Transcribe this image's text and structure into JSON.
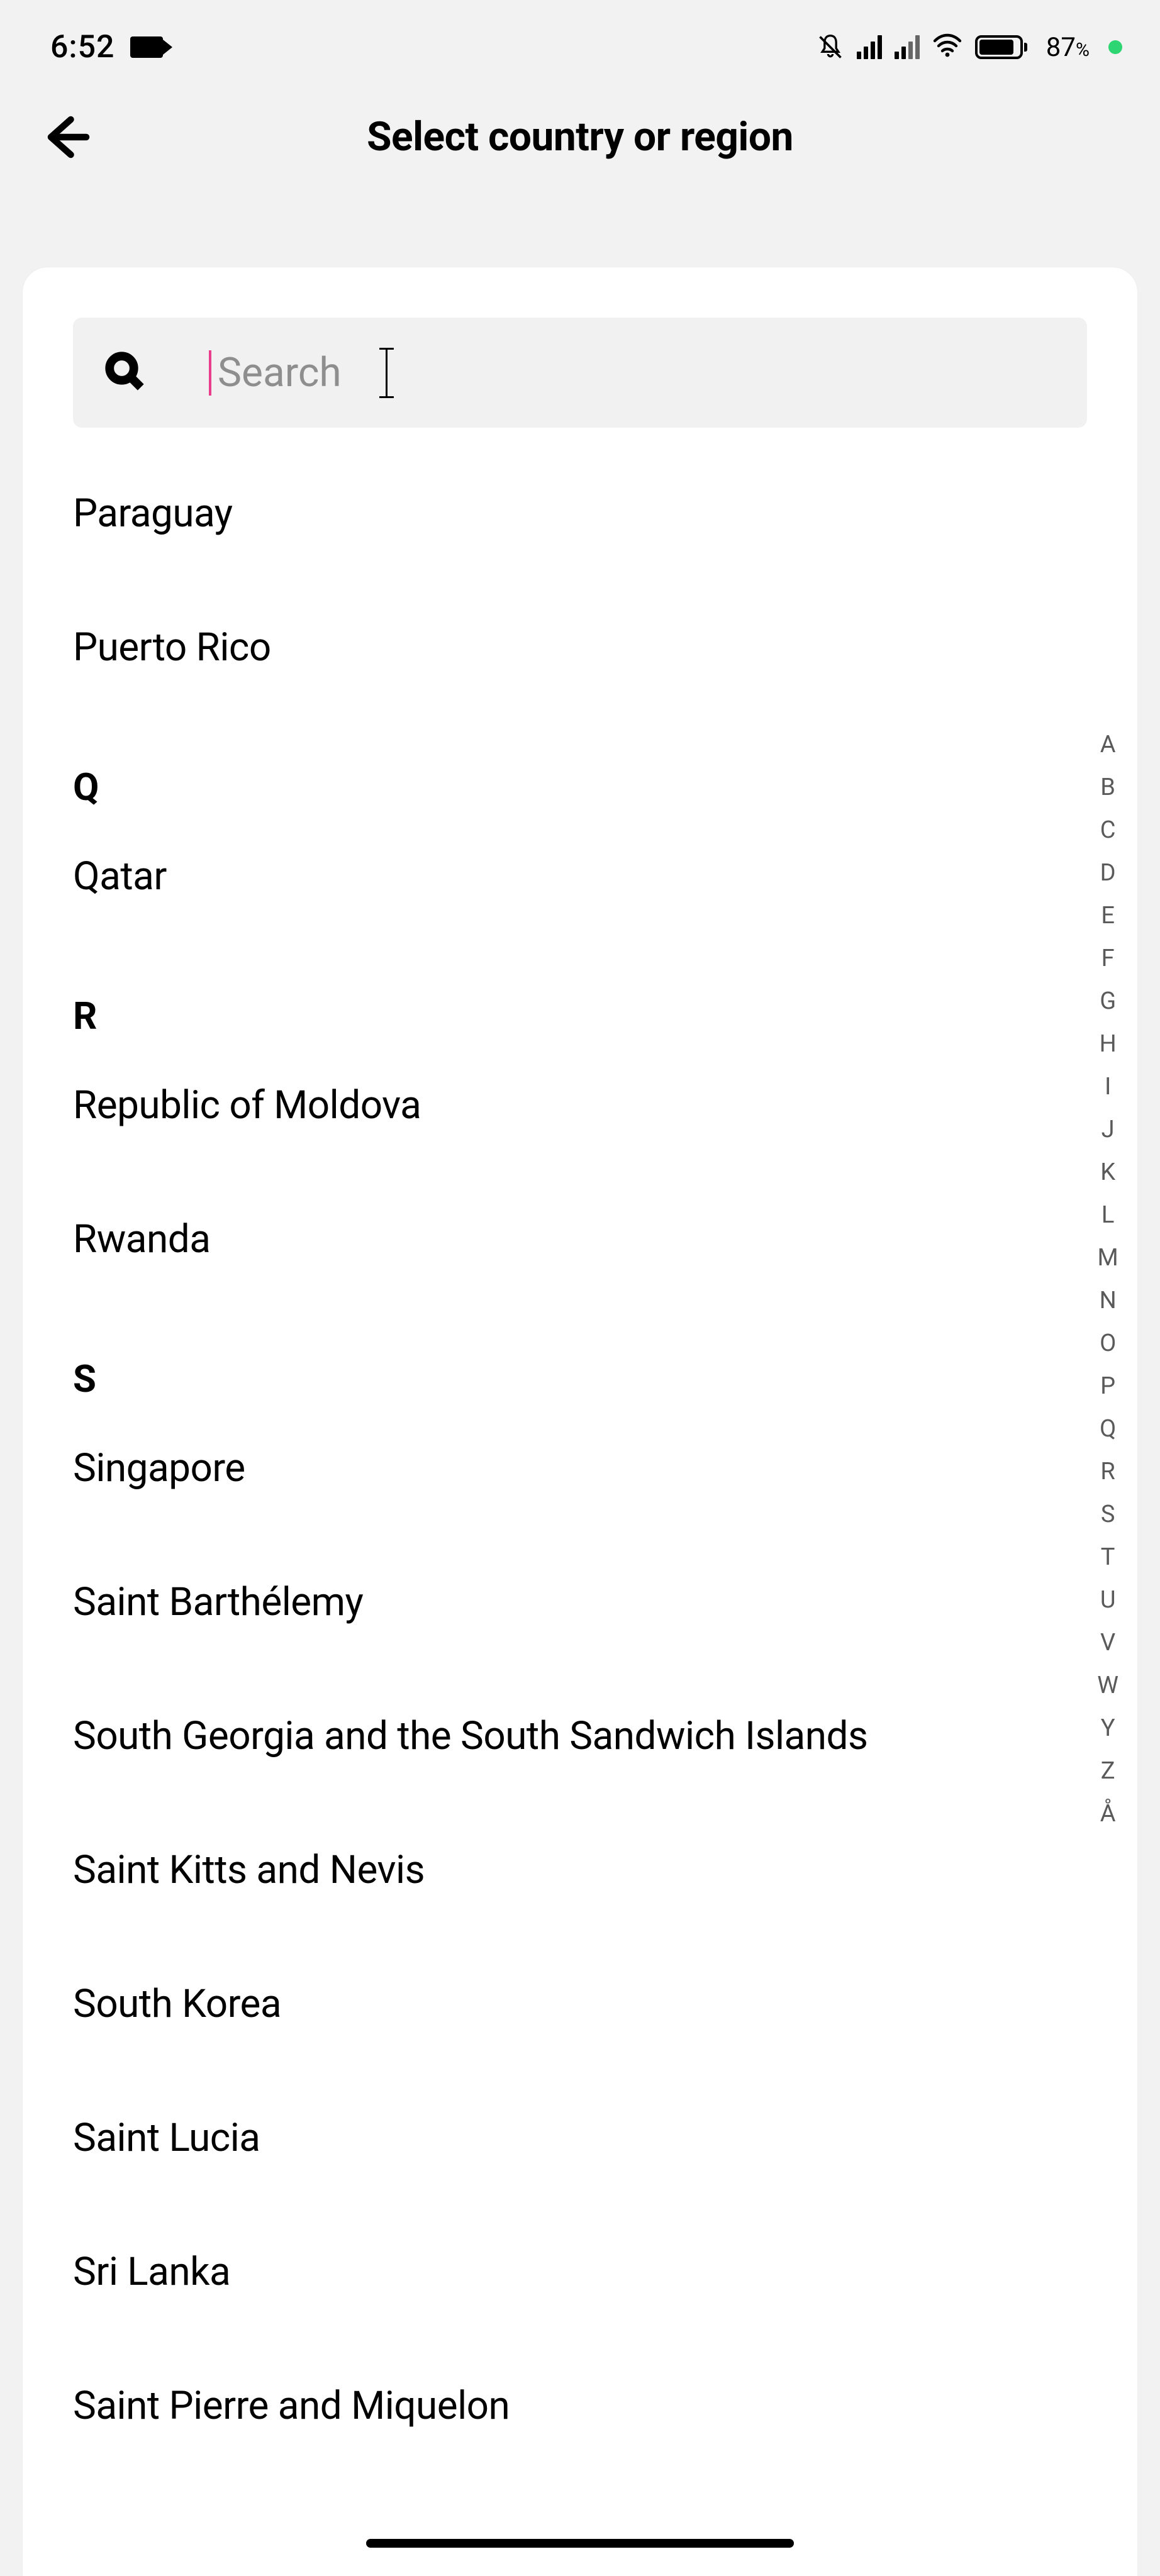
{
  "status": {
    "time": "6:52",
    "battery_pct": "87",
    "battery_unit": "%"
  },
  "header": {
    "title": "Select country or region"
  },
  "search": {
    "placeholder": "Search"
  },
  "sections": [
    {
      "letter": null,
      "items": [
        "Paraguay",
        "Puerto Rico"
      ]
    },
    {
      "letter": "Q",
      "items": [
        "Qatar"
      ]
    },
    {
      "letter": "R",
      "items": [
        "Republic of Moldova",
        "Rwanda"
      ]
    },
    {
      "letter": "S",
      "items": [
        "Singapore",
        "Saint Barthélemy",
        "South Georgia and the South Sandwich Islands",
        "Saint Kitts and Nevis",
        "South Korea",
        "Saint Lucia",
        "Sri Lanka",
        "Saint Pierre and Miquelon"
      ]
    }
  ],
  "alpha_index": [
    "A",
    "B",
    "C",
    "D",
    "E",
    "F",
    "G",
    "H",
    "I",
    "J",
    "K",
    "L",
    "M",
    "N",
    "O",
    "P",
    "Q",
    "R",
    "S",
    "T",
    "U",
    "V",
    "W",
    "Y",
    "Z",
    "Å"
  ]
}
